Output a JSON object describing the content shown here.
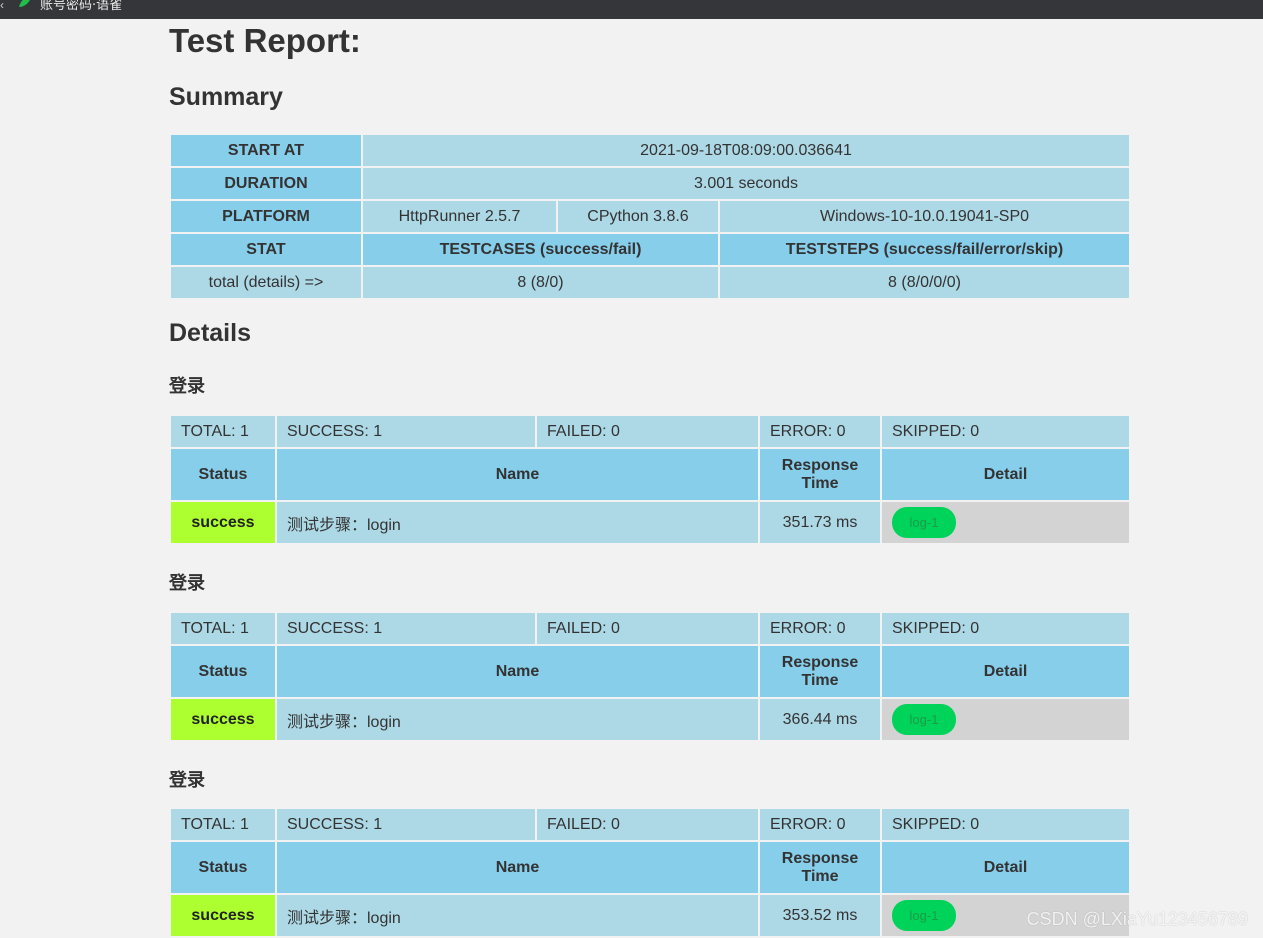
{
  "browser": {
    "back_glyph": "‹",
    "tab_title": "账号密码·语雀",
    "tab_icon": "leaf-icon"
  },
  "report": {
    "title": "Test Report:",
    "summary_heading": "Summary",
    "details_heading": "Details"
  },
  "summary": {
    "start_at_label": "START AT",
    "start_at_value": "2021-09-18T08:09:00.036641",
    "duration_label": "DURATION",
    "duration_value": "3.001 seconds",
    "platform_label": "PLATFORM",
    "platform_runner": "HttpRunner 2.5.7",
    "platform_python": "CPython 3.8.6",
    "platform_os": "Windows-10-10.0.19041-SP0",
    "stat_label": "STAT",
    "testcases_header": "TESTCASES (success/fail)",
    "teststeps_header": "TESTSTEPS (success/fail/error/skip)",
    "total_label": "total (details) =>",
    "testcases_value": "8 (8/0)",
    "teststeps_value": "8 (8/0/0/0)"
  },
  "details": [
    {
      "name": "登录",
      "total": "TOTAL: 1",
      "success": "SUCCESS: 1",
      "failed": "FAILED: 0",
      "error": "ERROR: 0",
      "skipped": "SKIPPED: 0",
      "col_status": "Status",
      "col_name": "Name",
      "col_response_line1": "Response",
      "col_response_line2": "Time",
      "col_detail": "Detail",
      "row": {
        "status": "success",
        "name": "测试步骤：login",
        "response_time": "351.73 ms",
        "log": "log-1"
      }
    },
    {
      "name": "登录",
      "total": "TOTAL: 1",
      "success": "SUCCESS: 1",
      "failed": "FAILED: 0",
      "error": "ERROR: 0",
      "skipped": "SKIPPED: 0",
      "col_status": "Status",
      "col_name": "Name",
      "col_response_line1": "Response",
      "col_response_line2": "Time",
      "col_detail": "Detail",
      "row": {
        "status": "success",
        "name": "测试步骤：login",
        "response_time": "366.44 ms",
        "log": "log-1"
      }
    },
    {
      "name": "登录",
      "total": "TOTAL: 1",
      "success": "SUCCESS: 1",
      "failed": "FAILED: 0",
      "error": "ERROR: 0",
      "skipped": "SKIPPED: 0",
      "col_status": "Status",
      "col_name": "Name",
      "col_response_line1": "Response",
      "col_response_line2": "Time",
      "col_detail": "Detail",
      "row": {
        "status": "success",
        "name": "测试步骤：login",
        "response_time": "353.52 ms",
        "log": "log-1"
      }
    }
  ],
  "colors": {
    "header_bg": "#87ceeb",
    "cell_bg": "#add8e6",
    "success_bg": "#adff2f",
    "detail_bg": "#d3d3d3",
    "log_button": "#00d35a",
    "page_bg": "#f2f2f2"
  },
  "watermark": "CSDN @LXiaYu123456789"
}
